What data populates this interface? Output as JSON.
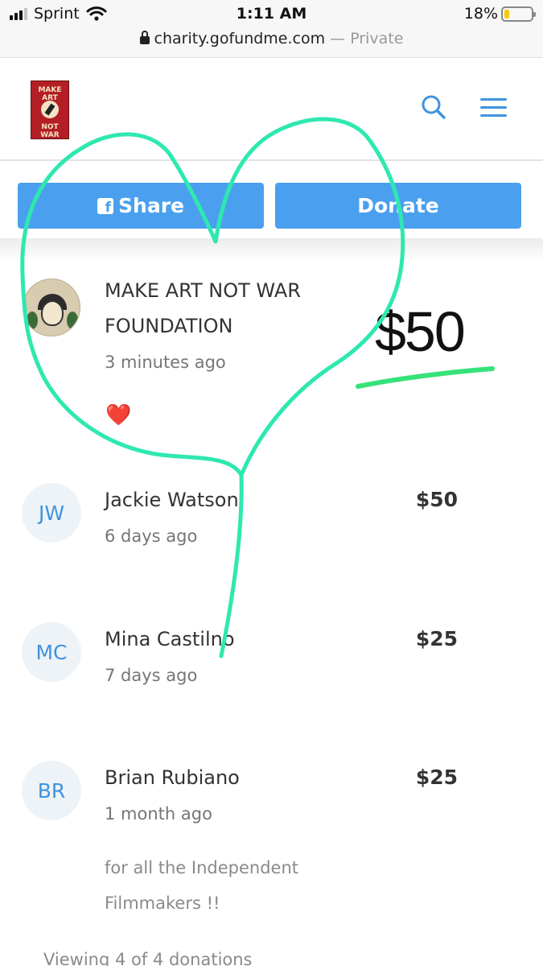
{
  "status_bar": {
    "carrier": "Sprint",
    "time": "1:11 AM",
    "battery": "18%",
    "battery_level": 0.18
  },
  "browser": {
    "url": "charity.gofundme.com",
    "separator": " — ",
    "mode": "Private"
  },
  "header": {
    "logo_line1": "MAKE ART",
    "logo_line2": "NOT WAR",
    "icons": [
      "search-icon",
      "menu-icon"
    ]
  },
  "actions": {
    "share_label": "Share",
    "donate_label": "Donate"
  },
  "donations": [
    {
      "name_line1": "MAKE ART NOT WAR",
      "name_line2": "FOUNDATION",
      "time": "3 minutes ago",
      "amount": "$50",
      "reaction": "❤️"
    },
    {
      "initials": "JW",
      "name": "Jackie Watson",
      "time": "6 days ago",
      "amount": "$50"
    },
    {
      "initials": "MC",
      "name": "Mina Castilno",
      "time": "7 days ago",
      "amount": "$25"
    },
    {
      "initials": "BR",
      "name": "Brian Rubiano",
      "time": "1 month ago",
      "amount": "$25",
      "comment": "for all the Independent Filmmakers !!"
    }
  ],
  "footer": {
    "viewing": "Viewing 4 of 4 donations"
  },
  "colors": {
    "accent": "#4aa0ee",
    "marker": "#2ee8b0",
    "underline": "#36e27a"
  }
}
